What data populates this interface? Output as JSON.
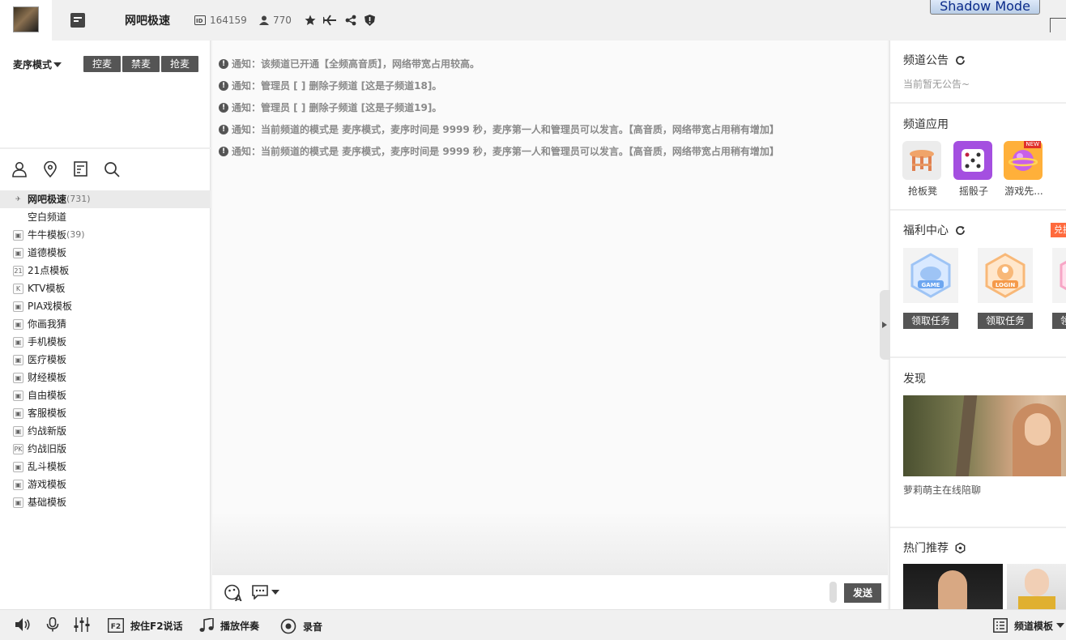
{
  "topbar": {
    "channel_name": "网吧极速",
    "channel_id": "164159",
    "member_count": "770",
    "shadow_mode_label": "Shadow Mode"
  },
  "left": {
    "mode_select": "麦序模式",
    "mode_buttons": [
      "控麦",
      "禁麦",
      "抢麦"
    ],
    "channels": [
      {
        "name": "网吧极速",
        "count": "(731)",
        "icon": "pin-icon",
        "active": true
      },
      {
        "name": "空白频道",
        "count": "",
        "icon": "",
        "active": false
      },
      {
        "name": "牛牛模板",
        "count": "(39)",
        "icon": "lock-icon"
      },
      {
        "name": "道德模板",
        "count": "",
        "icon": "lock-icon"
      },
      {
        "name": "21点模板",
        "count": "",
        "icon": "21-icon"
      },
      {
        "name": "KTV模板",
        "count": "",
        "icon": "k-icon"
      },
      {
        "name": "PIA戏模板",
        "count": "",
        "icon": "lock-icon"
      },
      {
        "name": "你画我猜",
        "count": "",
        "icon": "lock-icon"
      },
      {
        "name": "手机模板",
        "count": "",
        "icon": "lock-icon"
      },
      {
        "name": "医疗模板",
        "count": "",
        "icon": "lock-icon"
      },
      {
        "name": "财经模板",
        "count": "",
        "icon": "lock-icon"
      },
      {
        "name": "自由模板",
        "count": "",
        "icon": "lock-icon"
      },
      {
        "name": "客服模板",
        "count": "",
        "icon": "lock-icon"
      },
      {
        "name": "约战新版",
        "count": "",
        "icon": "lock-icon"
      },
      {
        "name": "约战旧版",
        "count": "",
        "icon": "pk-icon"
      },
      {
        "name": "乱斗模板",
        "count": "",
        "icon": "lock-icon"
      },
      {
        "name": "游戏模板",
        "count": "",
        "icon": "lock-icon"
      },
      {
        "name": "基础模板",
        "count": "",
        "icon": "lock-icon"
      }
    ]
  },
  "messages": [
    "通知：该频道已开通【全频高音质】，网络带宽占用较高。",
    "通知：管理员 [ ] 删除子频道 [这是子频道18]。",
    "通知：管理员 [ ] 删除子频道 [这是子频道19]。",
    "通知：当前频道的模式是 麦序模式，麦序时间是 9999 秒，麦序第一人和管理员可以发言。【高音质，网络带宽占用稍有增加】",
    "通知：当前频道的模式是 麦序模式，麦序时间是 9999 秒，麦序第一人和管理员可以发言。【高音质，网络带宽占用稍有增加】"
  ],
  "input": {
    "send_label": "发送"
  },
  "right": {
    "announcement_title": "频道公告",
    "announcement_text": "当前暂无公告~",
    "apps_title": "频道应用",
    "apps": [
      {
        "label": "抢板凳",
        "color": "#f2e7df"
      },
      {
        "label": "摇骰子",
        "color": "#a44fe0"
      },
      {
        "label": "游戏先...",
        "color": "#ffb03a"
      }
    ],
    "welfare_title": "福利中心",
    "exchange_tag": "兑换",
    "welfare_items": [
      {
        "badge_text": "GAME",
        "color": "#9ec4f5",
        "button": "领取任务"
      },
      {
        "badge_text": "LOGIN",
        "color": "#f8b878",
        "button": "领取任务"
      },
      {
        "badge_text": "",
        "color": "#f7a6c6",
        "button": "领取任务"
      }
    ],
    "discover_title": "发现",
    "discover_caption": "萝莉萌主在线陪聊",
    "hot_title": "热门推荐"
  },
  "bottombar": {
    "ptt_label": "按住F2说话",
    "ptt_key": "F2",
    "music_label": "播放伴奏",
    "record_label": "录音",
    "template_label": "频道模板"
  }
}
